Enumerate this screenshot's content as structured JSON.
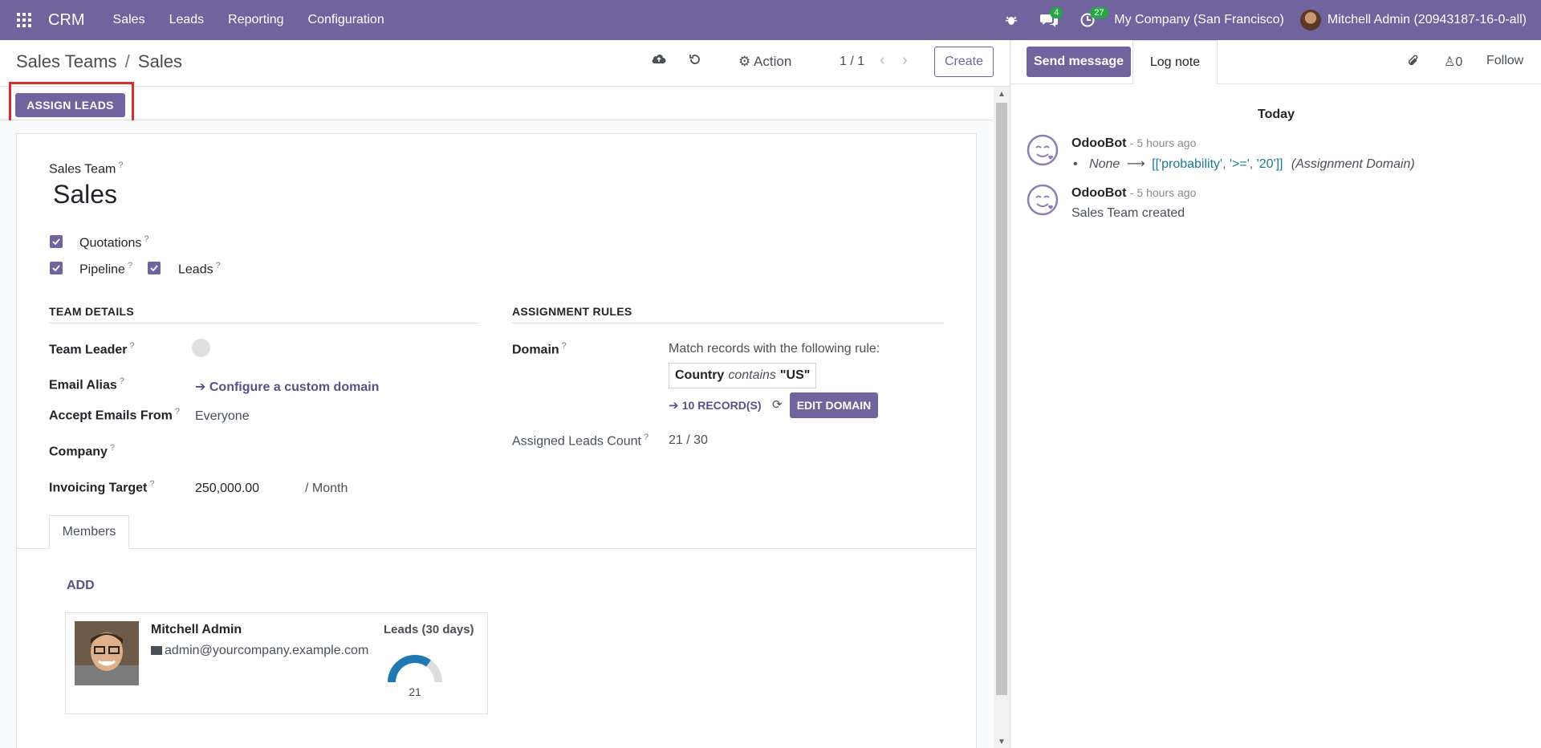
{
  "navbar": {
    "brand": "CRM",
    "menu": [
      "Sales",
      "Leads",
      "Reporting",
      "Configuration"
    ],
    "messages_count": "4",
    "activities_count": "27",
    "company": "My Company (San Francisco)",
    "user": "Mitchell Admin (20943187-16-0-all)"
  },
  "breadcrumb": {
    "parent": "Sales Teams",
    "separator": "/",
    "current": "Sales"
  },
  "control": {
    "action_label": "Action",
    "pager": "1 / 1",
    "create_label": "Create"
  },
  "statusbar": {
    "assign_leads": "ASSIGN LEADS"
  },
  "form": {
    "sales_team_label": "Sales Team",
    "name": "Sales",
    "quotations_label": "Quotations",
    "pipeline_label": "Pipeline",
    "leads_label": "Leads",
    "help_mark": "?",
    "team_details_title": "TEAM DETAILS",
    "team_leader_label": "Team Leader",
    "email_alias_label": "Email Alias",
    "email_alias_link": "Configure a custom domain",
    "accept_emails_label": "Accept Emails From",
    "accept_emails_value": "Everyone",
    "company_label": "Company",
    "invoicing_target_label": "Invoicing Target",
    "invoicing_target_value": "250,000.00",
    "invoicing_target_unit": "/ Month",
    "assignment_rules_title": "ASSIGNMENT RULES",
    "domain_label": "Domain",
    "domain_intro": "Match records with the following rule:",
    "domain_field": "Country",
    "domain_operator": "contains",
    "domain_value": "\"US\"",
    "records_link": "10 RECORD(S)",
    "edit_domain": "EDIT DOMAIN",
    "assigned_leads_label": "Assigned Leads Count",
    "assigned_leads_value": "21 / 30"
  },
  "tabs": {
    "members": "Members"
  },
  "members": {
    "add_label": "ADD",
    "card": {
      "name": "Mitchell Admin",
      "email": "admin@yourcompany.example.com",
      "leads_title": "Leads (30 days)",
      "leads_value": "21",
      "leads_gauge": {
        "value": 21,
        "max": 30
      }
    }
  },
  "chatter": {
    "send_message": "Send message",
    "log_note": "Log note",
    "followers_count": "0",
    "follow": "Follow",
    "date_separator": "Today",
    "messages": [
      {
        "author": "OdooBot",
        "time": "- 5 hours ago",
        "old_value": "None",
        "new_value": "[['probability', '>=', '20']]",
        "field": "(Assignment Domain)"
      },
      {
        "author": "OdooBot",
        "time": "- 5 hours ago",
        "body": "Sales Team created"
      }
    ]
  },
  "colors": {
    "brand": "#71639e",
    "badge": "#28a745",
    "highlight": "#d32f2f",
    "gauge_fill": "#1f78b4",
    "gauge_bg": "#dddddd"
  }
}
